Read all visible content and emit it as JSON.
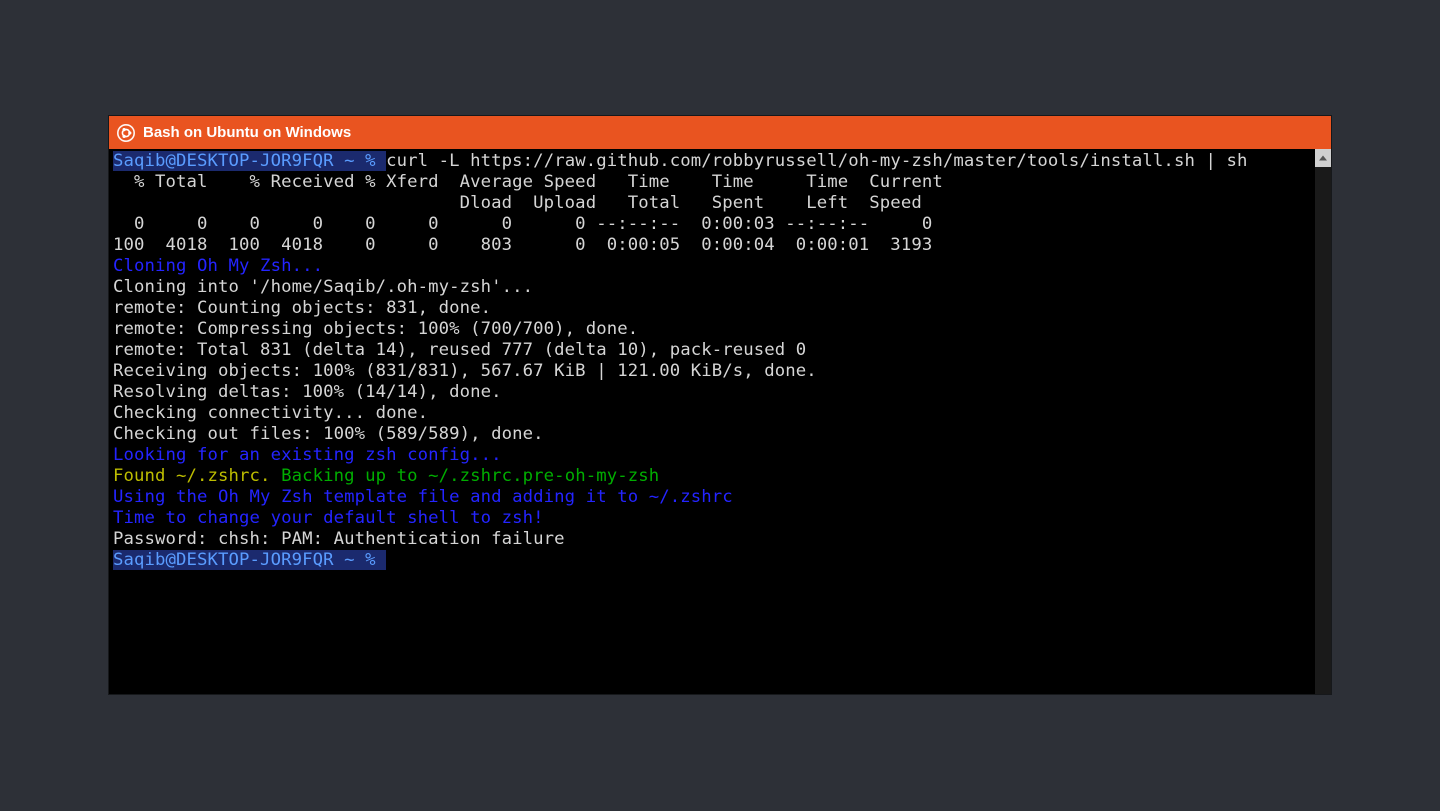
{
  "titlebar": {
    "title": "Bash on Ubuntu on Windows",
    "icon": "ubuntu-icon"
  },
  "prompt1": {
    "userhost": "Saqib@DESKTOP-JOR9FQR",
    "path": " ~ % ",
    "command": "curl -L https://raw.github.com/robbyrussell/oh-my-zsh/master/tools/install.sh | sh"
  },
  "curl_header1": "  % Total    % Received % Xferd  Average Speed   Time    Time     Time  Current",
  "curl_header2": "                                 Dload  Upload   Total   Spent    Left  Speed",
  "curl_row1": "  0     0    0     0    0     0      0      0 --:--:--  0:00:03 --:--:--     0",
  "curl_row2": "100  4018  100  4018    0     0    803      0  0:00:05  0:00:04  0:00:01  3193",
  "msg_cloning_header": "Cloning Oh My Zsh...",
  "git": {
    "into": "Cloning into '/home/Saqib/.oh-my-zsh'...",
    "counting": "remote: Counting objects: 831, done.",
    "compress": "remote: Compressing objects: 100% (700/700), done.",
    "total": "remote: Total 831 (delta 14), reused 777 (delta 10), pack-reused 0",
    "receiving": "Receiving objects: 100% (831/831), 567.67 KiB | 121.00 KiB/s, done.",
    "deltas": "Resolving deltas: 100% (14/14), done.",
    "connect": "Checking connectivity... done.",
    "checkout": "Checking out files: 100% (589/589), done."
  },
  "msg_looking": "Looking for an existing zsh config...",
  "found_prefix": "Found ~/.zshrc. ",
  "found_suffix": "Backing up to ~/.zshrc.pre-oh-my-zsh",
  "msg_using": "Using the Oh My Zsh template file and adding it to ~/.zshrc",
  "msg_time": "Time to change your default shell to zsh!",
  "password": "Password: chsh: PAM: Authentication failure",
  "prompt2": {
    "userhost": "Saqib@DESKTOP-JOR9FQR",
    "path": " ~ % "
  }
}
